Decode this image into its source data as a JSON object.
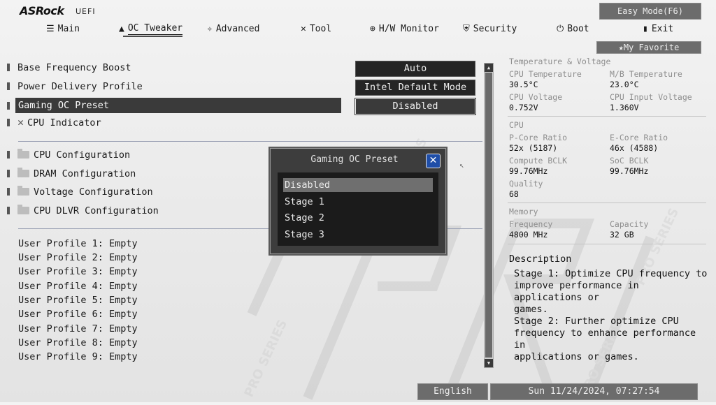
{
  "brand": {
    "logo": "ASRock",
    "sub": "UEFI"
  },
  "header": {
    "easy_mode": "Easy Mode(F6)",
    "my_favorite": "My Favorite",
    "nav": [
      {
        "label": "Main",
        "icon": "list-icon"
      },
      {
        "label": "OC Tweaker",
        "icon": "rocket-icon"
      },
      {
        "label": "Advanced",
        "icon": "star-icon"
      },
      {
        "label": "Tool",
        "icon": "tools-icon"
      },
      {
        "label": "H/W Monitor",
        "icon": "monitor-icon"
      },
      {
        "label": "Security",
        "icon": "shield-icon"
      },
      {
        "label": "Boot",
        "icon": "power-icon"
      },
      {
        "label": "Exit",
        "icon": "exit-icon"
      }
    ]
  },
  "menu": {
    "base_freq": {
      "label": "Base Frequency Boost",
      "value": "Auto"
    },
    "power_delivery": {
      "label": "Power Delivery Profile",
      "value": "Intel Default Mode"
    },
    "gaming_oc": {
      "label": "Gaming OC Preset",
      "value": "Disabled"
    },
    "cpu_indicator": {
      "label": "CPU Indicator"
    },
    "cpu_config": "CPU Configuration",
    "dram_config": "DRAM Configuration",
    "voltage_config": "Voltage Configuration",
    "dlvr_config": "CPU DLVR Configuration"
  },
  "profiles": [
    "User Profile 1: Empty",
    "User Profile 2: Empty",
    "User Profile 3: Empty",
    "User Profile 4: Empty",
    "User Profile 5: Empty",
    "User Profile 6: Empty",
    "User Profile 7: Empty",
    "User Profile 8: Empty",
    "User Profile 9: Empty"
  ],
  "popup": {
    "title": "Gaming OC Preset",
    "options": [
      "Disabled",
      "Stage 1",
      "Stage 2",
      "Stage 3"
    ],
    "selected_index": 0
  },
  "monitor": {
    "section1": "Temperature & Voltage",
    "cpu_temp_label": "CPU Temperature",
    "cpu_temp": "30.5°C",
    "mb_temp_label": "M/B Temperature",
    "mb_temp": "23.0°C",
    "cpu_volt_label": "CPU Voltage",
    "cpu_volt": "0.752V",
    "cpu_in_volt_label": "CPU Input Voltage",
    "cpu_in_volt": "1.360V",
    "section2": "CPU",
    "pcore_label": "P-Core Ratio",
    "pcore": "52x (5187)",
    "ecore_label": "E-Core Ratio",
    "ecore": "46x (4588)",
    "bclk_label": "Compute BCLK",
    "bclk": "99.76MHz",
    "soc_label": "SoC BCLK",
    "soc": "99.76MHz",
    "quality_label": "Quality",
    "quality": "68",
    "section3": "Memory",
    "freq_label": "Frequency",
    "freq": "4800 MHz",
    "cap_label": "Capacity",
    "cap": "32 GB"
  },
  "description": {
    "title": "Description",
    "text": "Stage 1: Optimize CPU frequency to\nimprove performance in applications or\ngames.\nStage 2: Further optimize CPU\nfrequency to enhance performance in\napplications or games."
  },
  "footer": {
    "language": "English",
    "datetime": "Sun 11/24/2024, 07:27:54"
  },
  "colors": {
    "accent_close": "#1f4ea8",
    "selected_row": "#3a3a3a"
  }
}
